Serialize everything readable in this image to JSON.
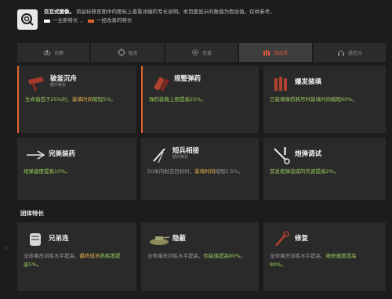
{
  "header": {
    "intro_title": "交互式图像。",
    "intro_text": "将鼠标移至图中的图标上查看详细的专长说明。本页面显示的数值为假设值，仅供参考。",
    "legend_white": "一全新特长",
    "legend_orange": "一经改善的特长",
    "legend_sep": "，"
  },
  "tabs": [
    {
      "label": "侦察",
      "icon": "binoculars-icon"
    },
    {
      "label": "狙击",
      "icon": "crosshair-icon"
    },
    {
      "label": "支援",
      "icon": "gear-icon"
    },
    {
      "label": "突击手",
      "icon": "ammo-icon"
    },
    {
      "label": "通信兵",
      "icon": "headset-icon"
    }
  ],
  "active_tab": 3,
  "cards": [
    {
      "title": "破釜沉舟",
      "subtitle": "额外特长",
      "desc_1": "生命值低于25%时，",
      "desc_hl": "装填时间",
      "desc_2": "缩短5%。",
      "highlight": true
    },
    {
      "title": "规整弹药",
      "subtitle": "",
      "desc_1": "弹药装载上限提高25%。",
      "desc_hl": "",
      "desc_2": "",
      "highlight": true
    },
    {
      "title": "爆发装填",
      "subtitle": "",
      "desc_1": "已装填弹药耗尽时装填时间缩短60%。",
      "desc_hl": "",
      "desc_2": "",
      "highlight": false
    },
    {
      "title": "完美装药",
      "subtitle": "",
      "desc_1": "炮弹速度提高10%。",
      "desc_hl": "",
      "desc_2": "",
      "highlight": false
    },
    {
      "title": "短兵相接",
      "subtitle": "额外特长",
      "desc_1": "50米内射击目标时，",
      "desc_hl": "装填时间",
      "desc_2": "缩短2.5%。",
      "highlight": false
    },
    {
      "title": "炮弹调试",
      "subtitle": "",
      "desc_1": "首发炮弹造成的伤害提高2%。",
      "desc_hl": "",
      "desc_2": "",
      "highlight": false
    }
  ],
  "section_title": "团体特长",
  "team_cards": [
    {
      "title": "兄弟连",
      "desc_1": "全体乘员训练水平提高，",
      "desc_hl": "最终成员",
      "desc_2": "熟练度提高5%。"
    },
    {
      "title": "隐蔽",
      "desc_1": "全体乘员训练水平提高，",
      "desc_hl": "",
      "desc_2": "伪装值提高80%。"
    },
    {
      "title": "修复",
      "desc_1": "全体乘员训练水平提高，",
      "desc_hl": "",
      "desc_2": "维修速度提高80%。"
    }
  ],
  "colors": {
    "accent": "#e0652a",
    "positive": "#9acc5c",
    "warning": "#e8b34a"
  }
}
